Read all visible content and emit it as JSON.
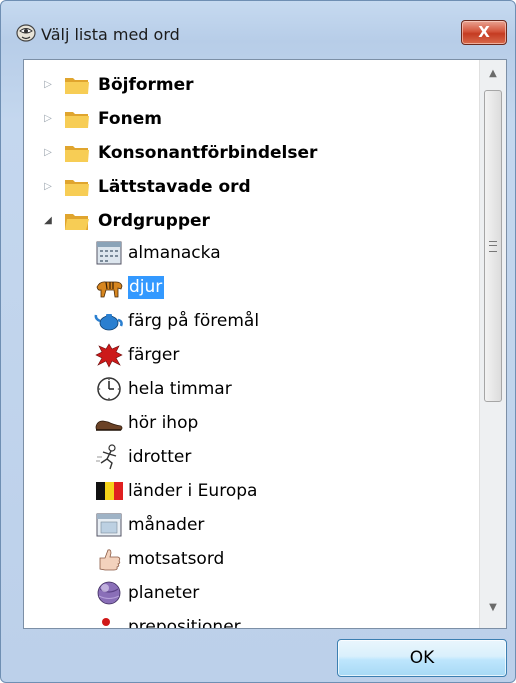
{
  "window": {
    "title": "Välj lista med ord",
    "close_label": "X"
  },
  "tree": {
    "folders": [
      {
        "label": "Böjformer",
        "expanded": false
      },
      {
        "label": "Fonem",
        "expanded": false
      },
      {
        "label": "Konsonantförbindelser",
        "expanded": false
      },
      {
        "label": "Lättstavade ord",
        "expanded": false
      },
      {
        "label": "Ordgrupper",
        "expanded": true
      }
    ],
    "items": [
      {
        "label": "almanacka",
        "icon": "calendar-icon"
      },
      {
        "label": "djur",
        "icon": "tiger-icon",
        "selected": true
      },
      {
        "label": "färg på föremål",
        "icon": "teapot-icon"
      },
      {
        "label": "färger",
        "icon": "paint-splash-icon"
      },
      {
        "label": "hela timmar",
        "icon": "clock-icon"
      },
      {
        "label": "hör ihop",
        "icon": "shoe-icon"
      },
      {
        "label": "idrotter",
        "icon": "running-person-icon"
      },
      {
        "label": "länder i Europa",
        "icon": "belgium-flag-icon"
      },
      {
        "label": "månader",
        "icon": "month-calendar-icon"
      },
      {
        "label": "motsatsord",
        "icon": "thumbs-up-icon"
      },
      {
        "label": "planeter",
        "icon": "planet-icon"
      },
      {
        "label": "prepositioner",
        "icon": "red-dot-icon"
      }
    ]
  },
  "buttons": {
    "ok_label": "OK"
  },
  "colors": {
    "selection": "#3399ff",
    "folder": "#f6c44a",
    "close_button": "#c9452b"
  }
}
